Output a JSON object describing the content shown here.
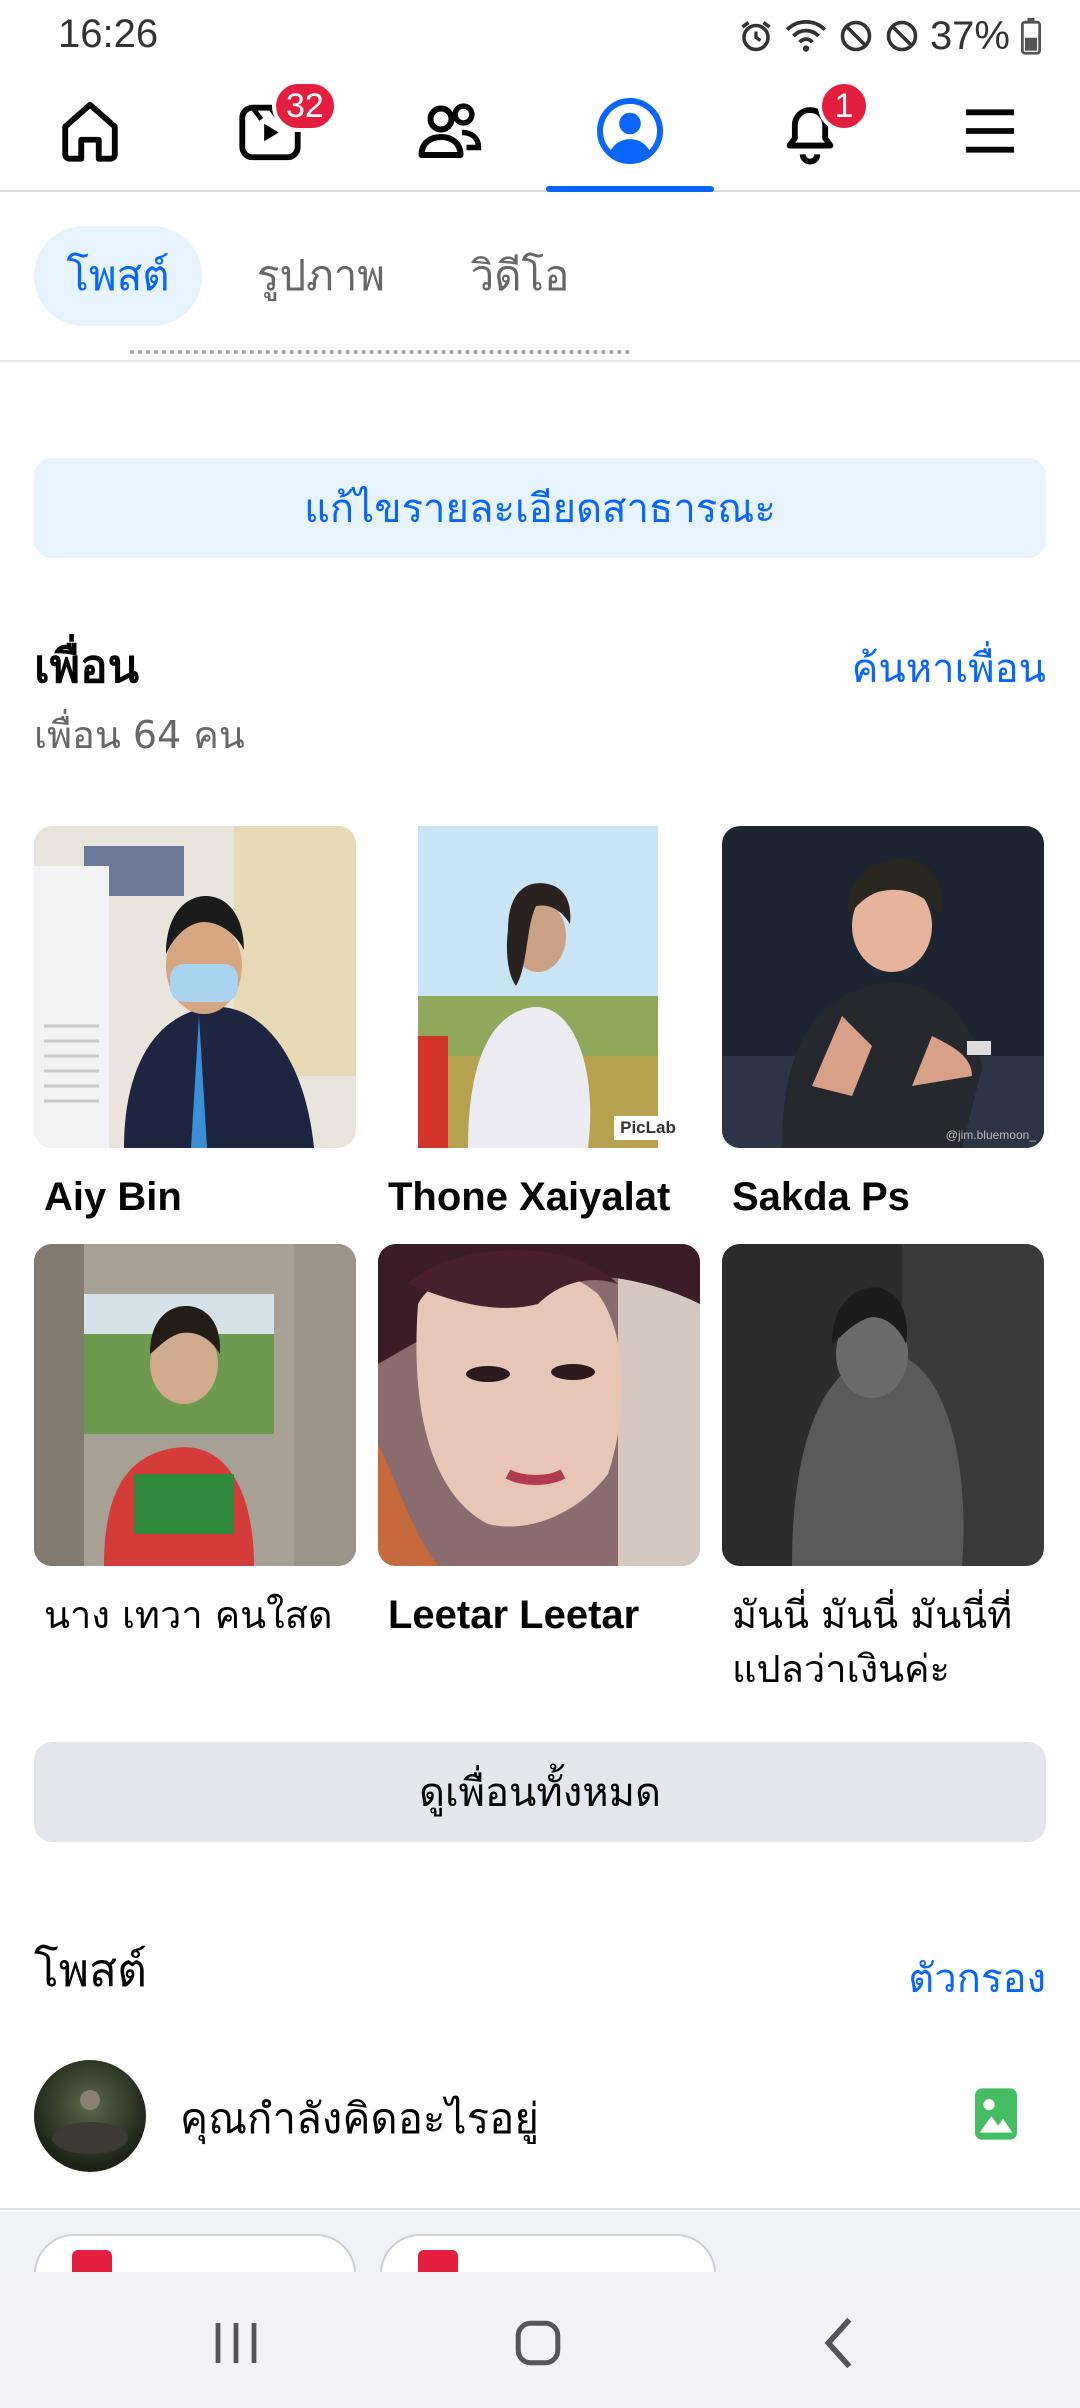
{
  "status_bar": {
    "time": "16:26",
    "battery_percent": "37%",
    "icons": [
      "alarm-icon",
      "wifi-icon",
      "block-icon",
      "block-icon",
      "battery-icon"
    ]
  },
  "nav": {
    "items": [
      {
        "name": "home",
        "icon": "home-icon"
      },
      {
        "name": "video",
        "icon": "video-icon",
        "badge": "32"
      },
      {
        "name": "friends",
        "icon": "friends-icon"
      },
      {
        "name": "profile",
        "icon": "profile-icon",
        "active": true
      },
      {
        "name": "notifications",
        "icon": "bell-icon",
        "badge": "1"
      },
      {
        "name": "menu",
        "icon": "hamburger-icon"
      }
    ],
    "accent_color": "#0866ff"
  },
  "tabs": {
    "posts": "โพสต์",
    "photos": "รูปภาพ",
    "videos": "วิดีโอ"
  },
  "edit_public_details": "แก้ไขรายละเอียดสาธารณะ",
  "friends": {
    "title": "เพื่อน",
    "find_link": "ค้นหาเพื่อน",
    "count_text": "เพื่อน 64 คน",
    "list": [
      {
        "name": "Aiy Bin"
      },
      {
        "name": "Thone Xaiyalat",
        "photo_tag": "PicLab"
      },
      {
        "name": "Sakda Ps",
        "photo_tag": "@jim.bluemoon_"
      },
      {
        "name": "นาง เทวา คนใสด"
      },
      {
        "name": "Leetar Leetar"
      },
      {
        "name_line1": "มันนี่ มันนี่ มันนี่ที่",
        "name_line2": "แปลว่าเงินค่ะ"
      }
    ],
    "see_all": "ดูเพื่อนทั้งหมด"
  },
  "posts": {
    "title": "โพสต์",
    "filter_link": "ตัวกรอง",
    "composer_placeholder": "คุณกำลังคิดอะไรอยู่"
  }
}
